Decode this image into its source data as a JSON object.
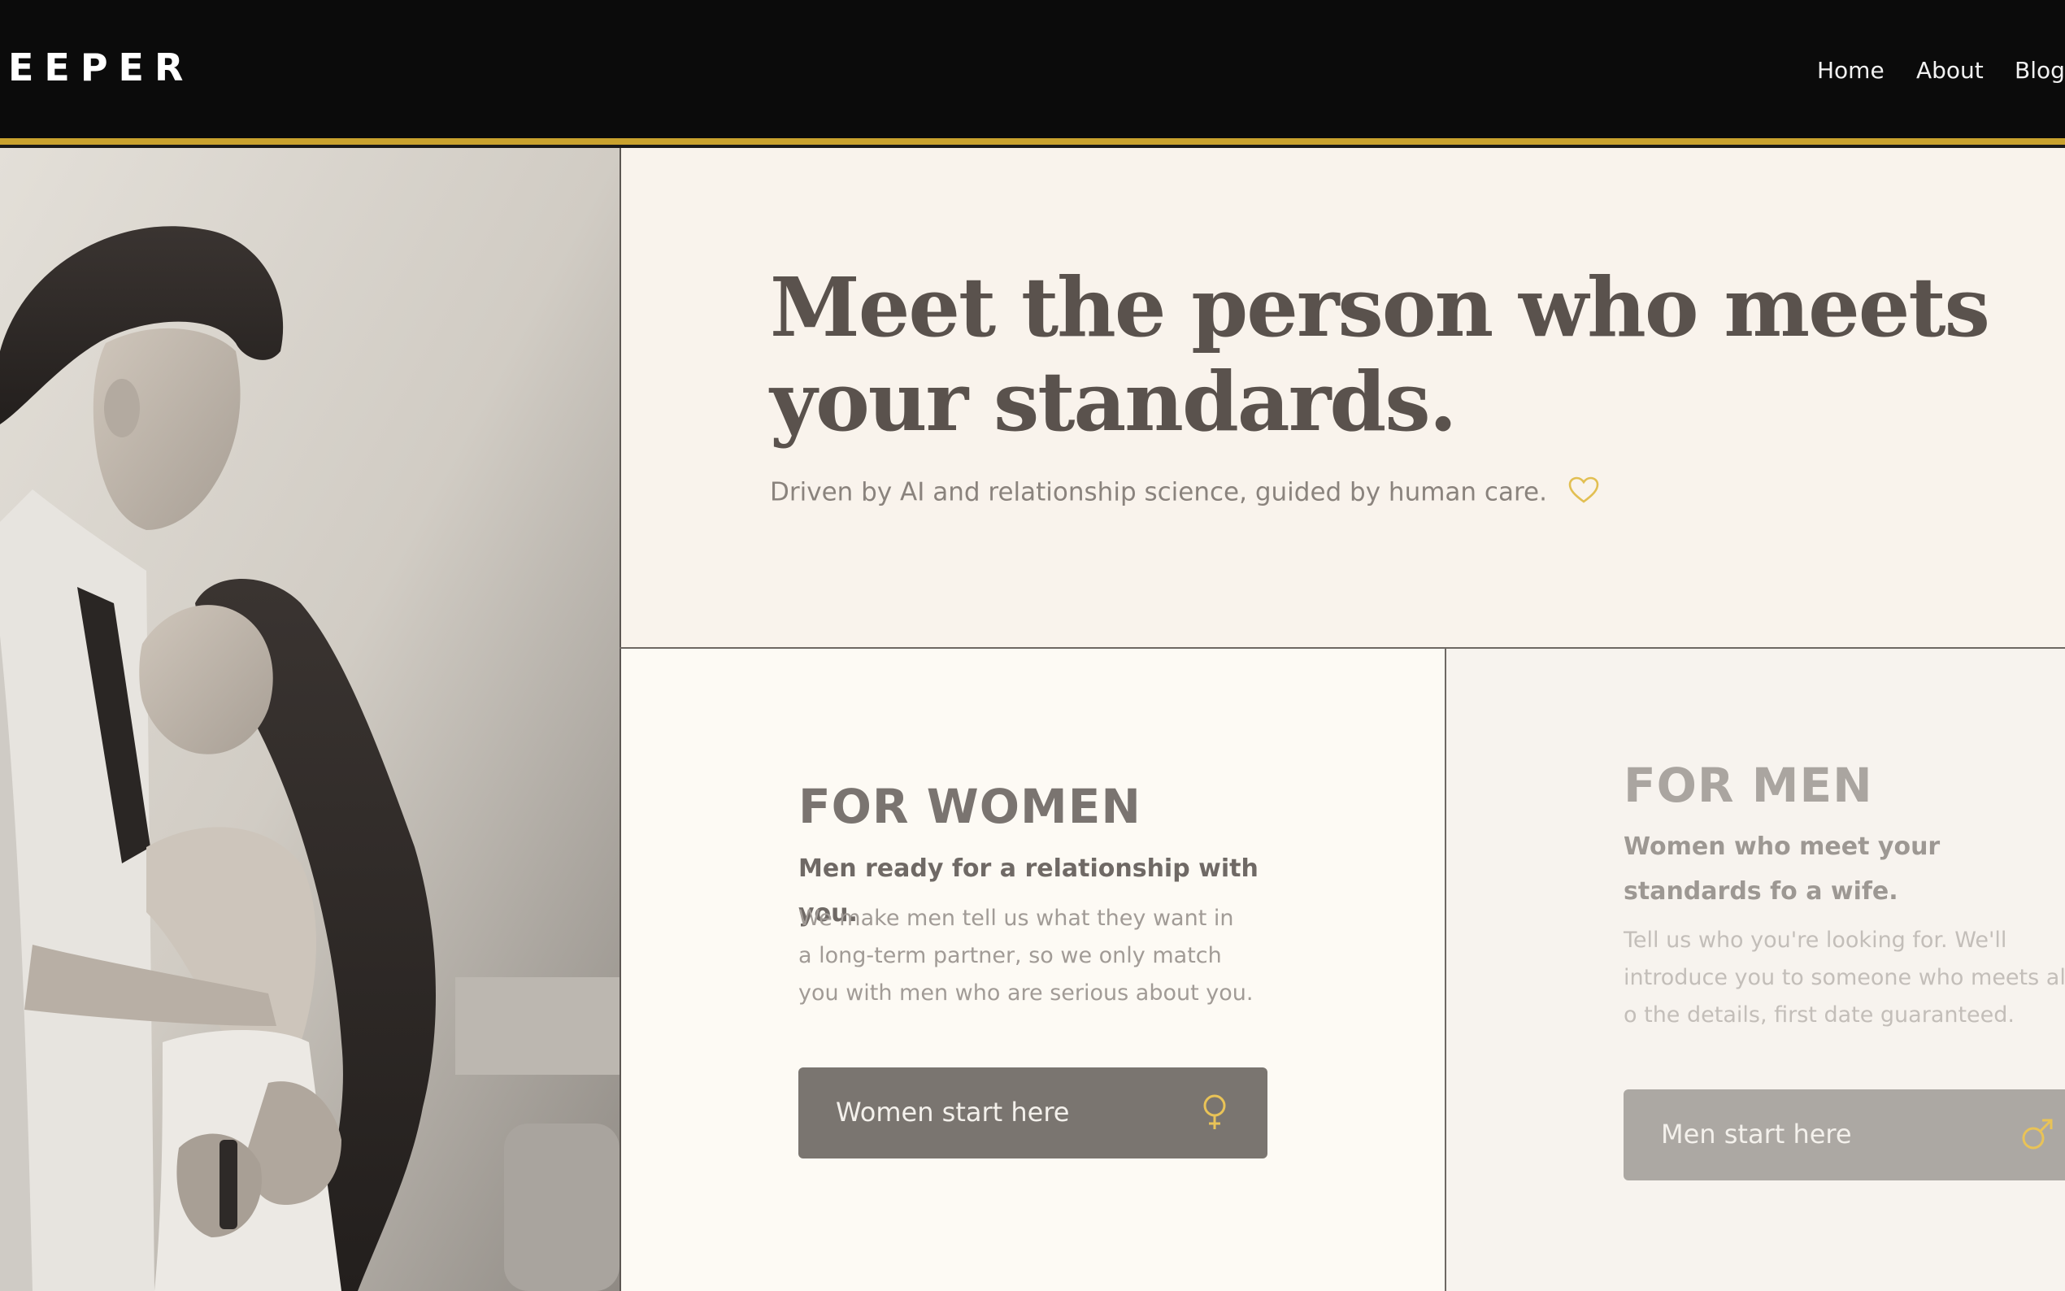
{
  "header": {
    "logo": "EEPER",
    "nav": [
      "Home",
      "About",
      "Blog"
    ]
  },
  "hero": {
    "title": "Meet the person who meets your standards.",
    "subtitle": "Driven by AI and relationship science, guided by human care."
  },
  "cards": {
    "women": {
      "title": "FOR WOMEN",
      "subtitle": "Men ready for a relationship with you.",
      "body": "We make men tell us what they want in a long-term partner, so we only match you with men who are serious about you.",
      "cta": "Women start here",
      "icon": "female-symbol-icon"
    },
    "men": {
      "title": "FOR MEN",
      "subtitle": "Women who meet your standards fo a wife.",
      "body": "Tell us who you're looking for. We'll introduce you to someone who meets all o the details, first date guaranteed.",
      "cta": "Men start here",
      "icon": "male-symbol-icon"
    }
  },
  "colors": {
    "accent_gold": "#c9a22e",
    "header_bg": "#0b0b0b",
    "hero_bg": "#f9f3ec",
    "button_women": "#7a7570",
    "button_men": "#aca8a3"
  }
}
